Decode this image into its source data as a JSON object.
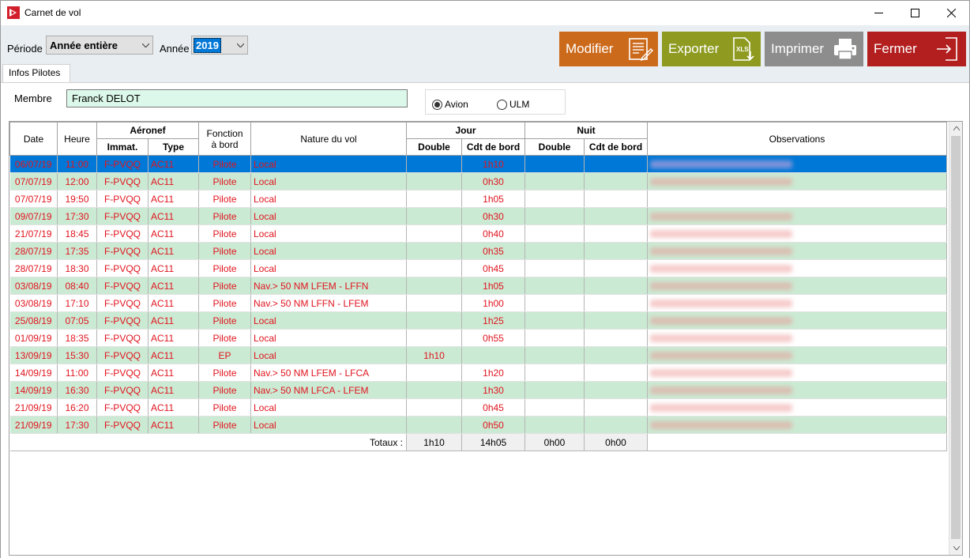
{
  "window": {
    "title": "Carnet de vol"
  },
  "toolbar": {
    "periode_label": "Période",
    "periode_value": "Année entière",
    "annee_label": "Année",
    "annee_value": "2019",
    "buttons": {
      "modifier": "Modifier",
      "exporter": "Exporter",
      "imprimer": "Imprimer",
      "fermer": "Fermer"
    },
    "export_icon_text": "XLS"
  },
  "tab": {
    "label": "Infos Pilotes"
  },
  "member": {
    "label": "Membre",
    "value": "Franck DELOT"
  },
  "aircraft_type": {
    "options": [
      "Avion",
      "ULM"
    ],
    "selected": "Avion"
  },
  "grid": {
    "headers": {
      "date": "Date",
      "heure": "Heure",
      "aeronef": "Aéronef",
      "immat": "Immat.",
      "type": "Type",
      "fonction_l1": "Fonction",
      "fonction_l2": "à bord",
      "nature": "Nature du vol",
      "jour": "Jour",
      "nuit": "Nuit",
      "double": "Double",
      "cdt": "Cdt de bord",
      "observations": "Observations"
    },
    "rows": [
      {
        "date": "06/07/19",
        "heure": "11:00",
        "immat": "F-PVQQ",
        "type": "AC11",
        "fonction": "Pilote",
        "nature": "Local",
        "jour_double": "",
        "jour_cdt": "1h10",
        "nuit_double": "",
        "nuit_cdt": "",
        "obs_blurred": true
      },
      {
        "date": "07/07/19",
        "heure": "12:00",
        "immat": "F-PVQQ",
        "type": "AC11",
        "fonction": "Pilote",
        "nature": "Local",
        "jour_double": "",
        "jour_cdt": "0h30",
        "nuit_double": "",
        "nuit_cdt": "",
        "obs_blurred": true
      },
      {
        "date": "07/07/19",
        "heure": "19:50",
        "immat": "F-PVQQ",
        "type": "AC11",
        "fonction": "Pilote",
        "nature": "Local",
        "jour_double": "",
        "jour_cdt": "1h05",
        "nuit_double": "",
        "nuit_cdt": "",
        "obs_blurred": false
      },
      {
        "date": "09/07/19",
        "heure": "17:30",
        "immat": "F-PVQQ",
        "type": "AC11",
        "fonction": "Pilote",
        "nature": "Local",
        "jour_double": "",
        "jour_cdt": "0h30",
        "nuit_double": "",
        "nuit_cdt": "",
        "obs_blurred": true
      },
      {
        "date": "21/07/19",
        "heure": "18:45",
        "immat": "F-PVQQ",
        "type": "AC11",
        "fonction": "Pilote",
        "nature": "Local",
        "jour_double": "",
        "jour_cdt": "0h40",
        "nuit_double": "",
        "nuit_cdt": "",
        "obs_blurred": true
      },
      {
        "date": "28/07/19",
        "heure": "17:35",
        "immat": "F-PVQQ",
        "type": "AC11",
        "fonction": "Pilote",
        "nature": "Local",
        "jour_double": "",
        "jour_cdt": "0h35",
        "nuit_double": "",
        "nuit_cdt": "",
        "obs_blurred": true
      },
      {
        "date": "28/07/19",
        "heure": "18:30",
        "immat": "F-PVQQ",
        "type": "AC11",
        "fonction": "Pilote",
        "nature": "Local",
        "jour_double": "",
        "jour_cdt": "0h45",
        "nuit_double": "",
        "nuit_cdt": "",
        "obs_blurred": true
      },
      {
        "date": "03/08/19",
        "heure": "08:40",
        "immat": "F-PVQQ",
        "type": "AC11",
        "fonction": "Pilote",
        "nature": "Nav.> 50 NM LFEM - LFFN",
        "jour_double": "",
        "jour_cdt": "1h05",
        "nuit_double": "",
        "nuit_cdt": "",
        "obs_blurred": true
      },
      {
        "date": "03/08/19",
        "heure": "17:10",
        "immat": "F-PVQQ",
        "type": "AC11",
        "fonction": "Pilote",
        "nature": "Nav.> 50 NM LFFN - LFEM",
        "jour_double": "",
        "jour_cdt": "1h00",
        "nuit_double": "",
        "nuit_cdt": "",
        "obs_blurred": true
      },
      {
        "date": "25/08/19",
        "heure": "07:05",
        "immat": "F-PVQQ",
        "type": "AC11",
        "fonction": "Pilote",
        "nature": "Local",
        "jour_double": "",
        "jour_cdt": "1h25",
        "nuit_double": "",
        "nuit_cdt": "",
        "obs_blurred": true
      },
      {
        "date": "01/09/19",
        "heure": "18:35",
        "immat": "F-PVQQ",
        "type": "AC11",
        "fonction": "Pilote",
        "nature": "Local",
        "jour_double": "",
        "jour_cdt": "0h55",
        "nuit_double": "",
        "nuit_cdt": "",
        "obs_blurred": true
      },
      {
        "date": "13/09/19",
        "heure": "15:30",
        "immat": "F-PVQQ",
        "type": "AC11",
        "fonction": "EP",
        "nature": "Local",
        "jour_double": "1h10",
        "jour_cdt": "",
        "nuit_double": "",
        "nuit_cdt": "",
        "obs_blurred": true
      },
      {
        "date": "14/09/19",
        "heure": "11:00",
        "immat": "F-PVQQ",
        "type": "AC11",
        "fonction": "Pilote",
        "nature": "Nav.> 50 NM LFEM - LFCA",
        "jour_double": "",
        "jour_cdt": "1h20",
        "nuit_double": "",
        "nuit_cdt": "",
        "obs_blurred": true
      },
      {
        "date": "14/09/19",
        "heure": "16:30",
        "immat": "F-PVQQ",
        "type": "AC11",
        "fonction": "Pilote",
        "nature": "Nav.> 50 NM LFCA - LFEM",
        "jour_double": "",
        "jour_cdt": "1h30",
        "nuit_double": "",
        "nuit_cdt": "",
        "obs_blurred": true
      },
      {
        "date": "21/09/19",
        "heure": "16:20",
        "immat": "F-PVQQ",
        "type": "AC11",
        "fonction": "Pilote",
        "nature": "Local",
        "jour_double": "",
        "jour_cdt": "0h45",
        "nuit_double": "",
        "nuit_cdt": "",
        "obs_blurred": true
      },
      {
        "date": "21/09/19",
        "heure": "17:30",
        "immat": "F-PVQQ",
        "type": "AC11",
        "fonction": "Pilote",
        "nature": "Local",
        "jour_double": "",
        "jour_cdt": "0h50",
        "nuit_double": "",
        "nuit_cdt": "",
        "obs_blurred": true
      }
    ],
    "selected_row": 0,
    "totals": {
      "label": "Totaux :",
      "jour_double": "1h10",
      "jour_cdt": "14h05",
      "nuit_double": "0h00",
      "nuit_cdt": "0h00"
    }
  },
  "colors": {
    "row_text": "#e0141e",
    "row_alt_bg": "#cbead3",
    "selection": "#0078d7",
    "btn_modifier": "#cc6a1c",
    "btn_exporter": "#8e9b20",
    "btn_imprimer": "#8d8d8d",
    "btn_fermer": "#b31e1e",
    "member_field_bg": "#dcf8ea"
  },
  "icons": [
    "app-logo-icon",
    "minimize-icon",
    "maximize-icon",
    "close-icon",
    "chevron-down-icon",
    "edit-document-icon",
    "xls-export-icon",
    "printer-icon",
    "exit-door-icon",
    "scroll-up-icon",
    "scroll-down-icon"
  ]
}
